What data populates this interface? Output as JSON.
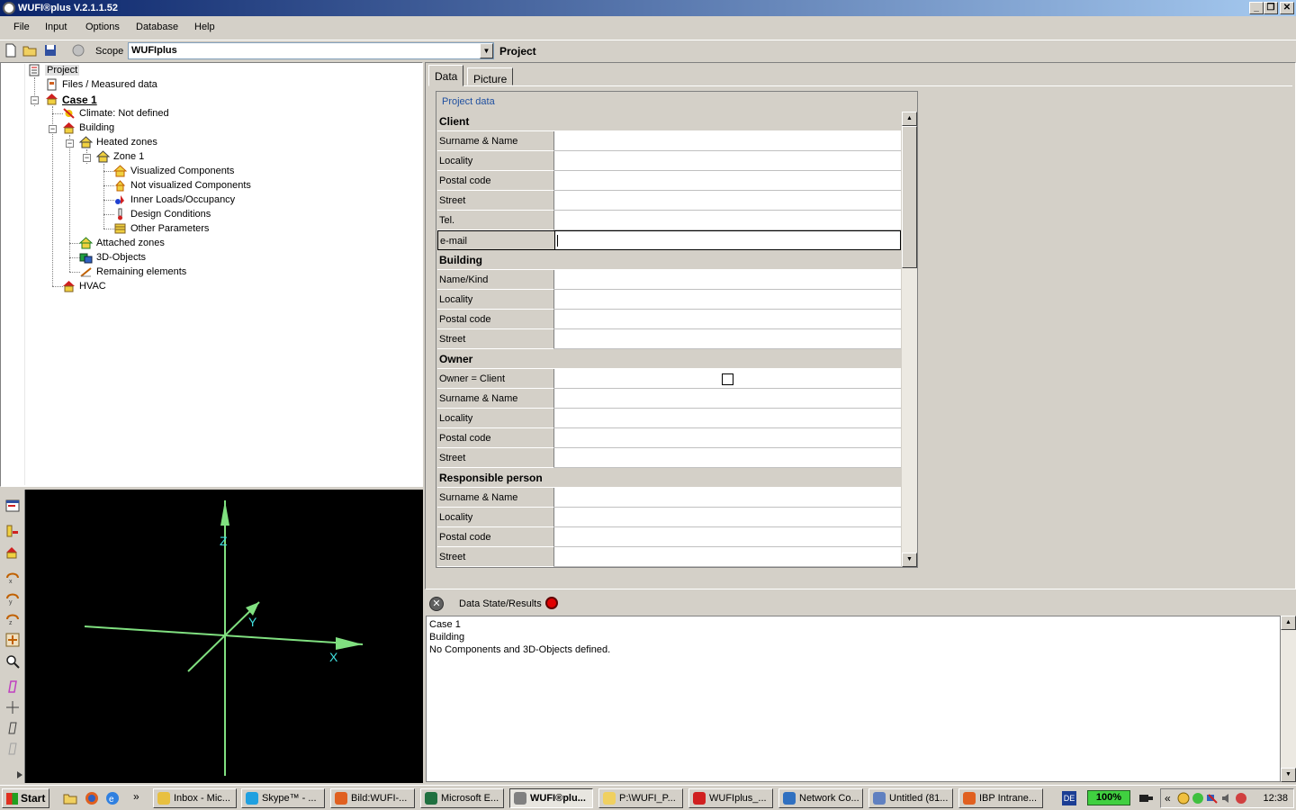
{
  "window": {
    "title": "WUFI®plus V.2.1.1.52"
  },
  "menu": [
    "File",
    "Input",
    "Options",
    "Database",
    "Help"
  ],
  "toolbar": {
    "scope_label": "Scope",
    "scope_value": "WUFIplus",
    "scope_context": "Project"
  },
  "tree": {
    "project": "Project",
    "files": "Files / Measured data",
    "case": "Case 1",
    "climate": "Climate: Not defined",
    "building": "Building",
    "heated_zones": "Heated zones",
    "zone1": "Zone 1",
    "visualized": "Visualized Components",
    "not_visualized": "Not visualized Components",
    "inner_loads": "Inner Loads/Occupancy",
    "design_conditions": "Design Conditions",
    "other_params": "Other Parameters",
    "attached_zones": "Attached zones",
    "objects3d": "3D-Objects",
    "remaining": "Remaining elements",
    "hvac": "HVAC"
  },
  "view3d": {
    "axis_x": "X",
    "axis_y": "Y",
    "axis_z": "Z"
  },
  "tabs": [
    "Data",
    "Picture"
  ],
  "project_data": {
    "group_title": "Project data",
    "rows": [
      {
        "label": "Client",
        "section": true
      },
      {
        "label": "Surname & Name"
      },
      {
        "label": "Locality"
      },
      {
        "label": "Postal code"
      },
      {
        "label": "Street"
      },
      {
        "label": "Tel."
      },
      {
        "label": "e-mail",
        "selected": true
      },
      {
        "label": "Building",
        "section": true
      },
      {
        "label": "Name/Kind"
      },
      {
        "label": "Locality"
      },
      {
        "label": "Postal code"
      },
      {
        "label": "Street"
      },
      {
        "label": "Owner",
        "section": true
      },
      {
        "label": "Owner = Client",
        "checkbox": true
      },
      {
        "label": "Surname & Name"
      },
      {
        "label": "Locality"
      },
      {
        "label": "Postal code"
      },
      {
        "label": "Street"
      },
      {
        "label": "Responsible person",
        "section": true
      },
      {
        "label": "Surname & Name"
      },
      {
        "label": "Locality"
      },
      {
        "label": "Postal code"
      },
      {
        "label": "Street"
      }
    ]
  },
  "results": {
    "title": "Data State/Results",
    "lines": [
      "Case 1",
      "Building",
      "No Components and 3D-Objects defined."
    ]
  },
  "taskbar": {
    "start": "Start",
    "tasks": [
      {
        "label": "Inbox - Mic...",
        "icon": "outlook-icon",
        "color": "#e8c040"
      },
      {
        "label": "Skype™ - ...",
        "icon": "skype-icon",
        "color": "#20a0e0"
      },
      {
        "label": "Bild:WUFI-...",
        "icon": "firefox-icon",
        "color": "#e06020"
      },
      {
        "label": "Microsoft E...",
        "icon": "excel-icon",
        "color": "#207040"
      },
      {
        "label": "WUFI®plu...",
        "icon": "wufi-icon",
        "color": "#808080",
        "active": true
      },
      {
        "label": "P:\\WUFI_P...",
        "icon": "folder-icon",
        "color": "#f0d060"
      },
      {
        "label": "WUFIplus_...",
        "icon": "pdf-icon",
        "color": "#d02020"
      },
      {
        "label": "Network Co...",
        "icon": "network-icon",
        "color": "#3070c0"
      },
      {
        "label": "Untitled (81...",
        "icon": "paint-icon",
        "color": "#6080c0"
      },
      {
        "label": "IBP Intrane...",
        "icon": "firefox-icon",
        "color": "#e06020"
      }
    ],
    "lang": "DE",
    "battery": "100%",
    "clock": "12:38"
  }
}
